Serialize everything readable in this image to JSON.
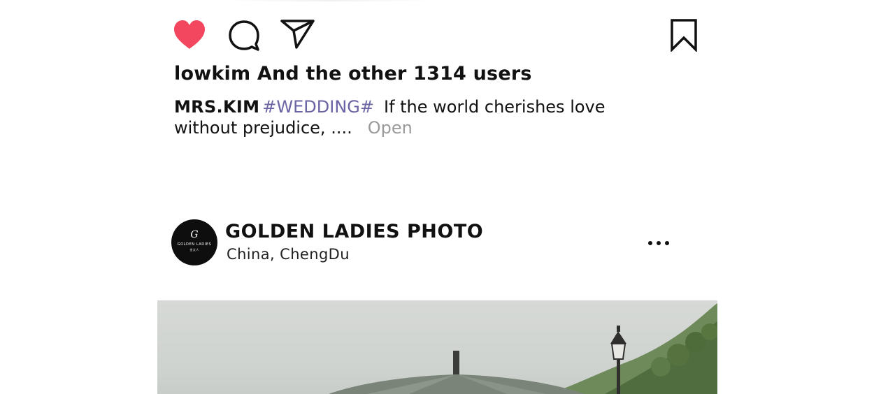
{
  "likes": {
    "text": "lowkim And the other 1314 users"
  },
  "caption": {
    "author": "MRS.KIM",
    "hashtag": "#WEDDING#",
    "text": "If the world cherishes love without prejudice, ....",
    "more_label": "Open"
  },
  "post": {
    "account_name": "GOLDEN LADIES PHOTO",
    "location": "China,  ChengDu",
    "avatar": {
      "monogram": "G",
      "line1": "GOLDEN LADIES",
      "line2": "金太人"
    }
  },
  "icons": {
    "like": "heart-icon",
    "comment": "comment-bubble-icon",
    "share": "paper-plane-icon",
    "bookmark": "bookmark-icon",
    "more": "more-dots-icon"
  },
  "colors": {
    "like": "#f2475e",
    "hashtag": "#6a64a4",
    "more_link": "#9a9a9a",
    "avatar_bg": "#0e0e0e"
  }
}
